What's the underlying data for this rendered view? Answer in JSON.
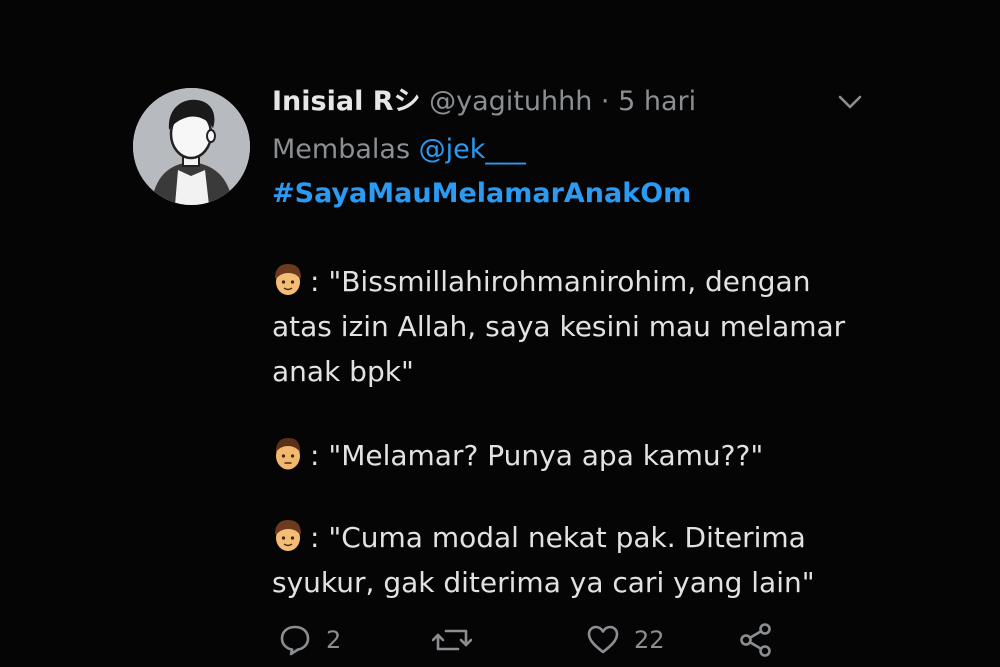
{
  "tweet": {
    "display_name": "Inisial Rシ",
    "handle": "@yagituhhh",
    "separator": "·",
    "time": "5 hari",
    "reply_prefix": "Membalas",
    "reply_to": "@jek___",
    "hashtag": "#SayaMauMelamarAnakOm",
    "dialogue": [
      {
        "speaker_icon": "boy-emoji-icon",
        "lines": [
          ": \"Bissmillahirohmanirohim, dengan",
          "atas izin Allah, saya kesini mau melamar",
          "anak bpk\""
        ]
      },
      {
        "speaker_icon": "man-emoji-icon",
        "lines": [
          ": \"Melamar? Punya apa kamu??\""
        ]
      },
      {
        "speaker_icon": "boy-emoji-icon",
        "lines": [
          ": \"Cuma modal nekat pak. Diterima",
          "syukur, gak diterima ya cari yang lain\""
        ]
      }
    ]
  },
  "actions": {
    "reply_count": "2",
    "retweet_count": "",
    "like_count": "22"
  },
  "colors": {
    "background": "#050505",
    "link": "#2b9af3",
    "muted": "#8b8f94",
    "text": "#e2e2e2"
  }
}
